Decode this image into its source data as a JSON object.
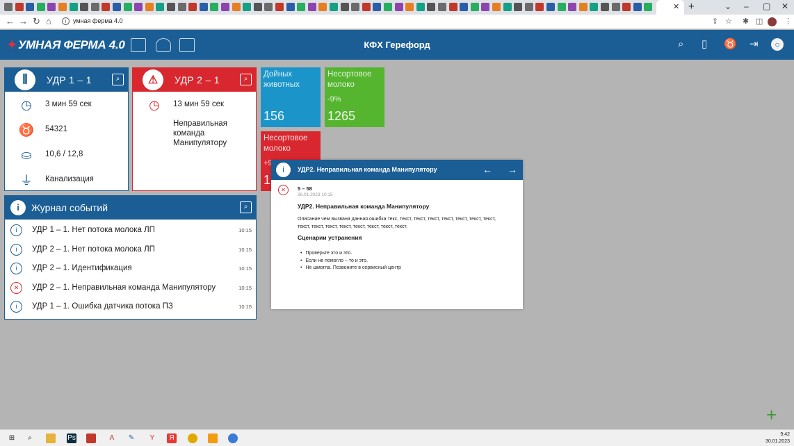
{
  "browser": {
    "tab_count": 60,
    "active_tab_close": "✕",
    "new_tab": "+",
    "window_controls": [
      "⌄",
      "–",
      "▢",
      "✕"
    ],
    "url": "умная ферма 4.0",
    "nav": {
      "back": "←",
      "forward": "→",
      "reload": "↻",
      "home": "⌂"
    },
    "toolbar_icons": [
      "share-icon",
      "star-icon",
      "extensions-icon",
      "sidebar-icon",
      "profile-icon",
      "menu-icon"
    ]
  },
  "header": {
    "logo": "УМНАЯ ФЕРМА 4.0",
    "farm_name": "КФХ Герефорд",
    "nav_icons": [
      "dashboard-icon",
      "cow-icon",
      "layout-icon"
    ],
    "right_icons": [
      "search-icon",
      "add-document-icon",
      "add-cow-icon",
      "logout-icon",
      "user-icon"
    ],
    "accent": "#1b5e95"
  },
  "cards": {
    "udr1": {
      "title": "УДР 1 – 1",
      "time": "3 мин 59 сек",
      "animal_id": "54321",
      "volume": "10,6 / 12,8",
      "status": "Канализация",
      "color": "#1b5e95"
    },
    "udr2": {
      "title": "УДР 2 – 1",
      "time": "13 мин 59 сек",
      "message": "Неправильная\nкоманда\nМанипулятору",
      "color": "#d9272f"
    }
  },
  "tiles": {
    "dairy": {
      "label": "Дойных животных",
      "value": "156",
      "color": "#1b95c9"
    },
    "nonstandard": {
      "label": "Несортовое молоко",
      "pct": "-9%",
      "value": "1265",
      "color": "#55b52f"
    },
    "nonstandard2": {
      "label": "Несортовое молоко",
      "pct": "+9",
      "value": "12",
      "color": "#d9272f"
    }
  },
  "journal": {
    "title": "Журнал событий",
    "items": [
      {
        "text": "УДР 1 – 1. Нет потока молока ЛП",
        "time": "10:15",
        "type": "info"
      },
      {
        "text": "УДР 2 – 1. Нет потока молока ЛП",
        "time": "10:15",
        "type": "info"
      },
      {
        "text": "УДР 2 – 1. Идентификация",
        "time": "10:15",
        "type": "info"
      },
      {
        "text": "УДР 2 – 1. Неправильная команда Манипулятору",
        "time": "10:15",
        "type": "error"
      },
      {
        "text": "УДР 1 – 1. Ошибка датчика потока ПЗ",
        "time": "10:15",
        "type": "info"
      }
    ]
  },
  "modal": {
    "title": "УДР2. Неправильная команда Манипулятору",
    "code": "5 – 58",
    "date": "26.01.2023 10:15",
    "heading": "УДР2. Неправильная команда Манипулятору",
    "description": "Описание чем вызвана данная ошибка текс, текст, текст, текст, текст, текст, текст, текст, текст, текст, текст, текст, текст, текст, текст, текст.",
    "scenario_title": "Сценарии устранения",
    "steps": [
      "Проверьте это и это.",
      "Если не помогло – то и это.",
      "Не шмогла. Позвоните в сервисный центр"
    ]
  },
  "taskbar": {
    "time": "9:42",
    "date": "30.01.2023"
  }
}
